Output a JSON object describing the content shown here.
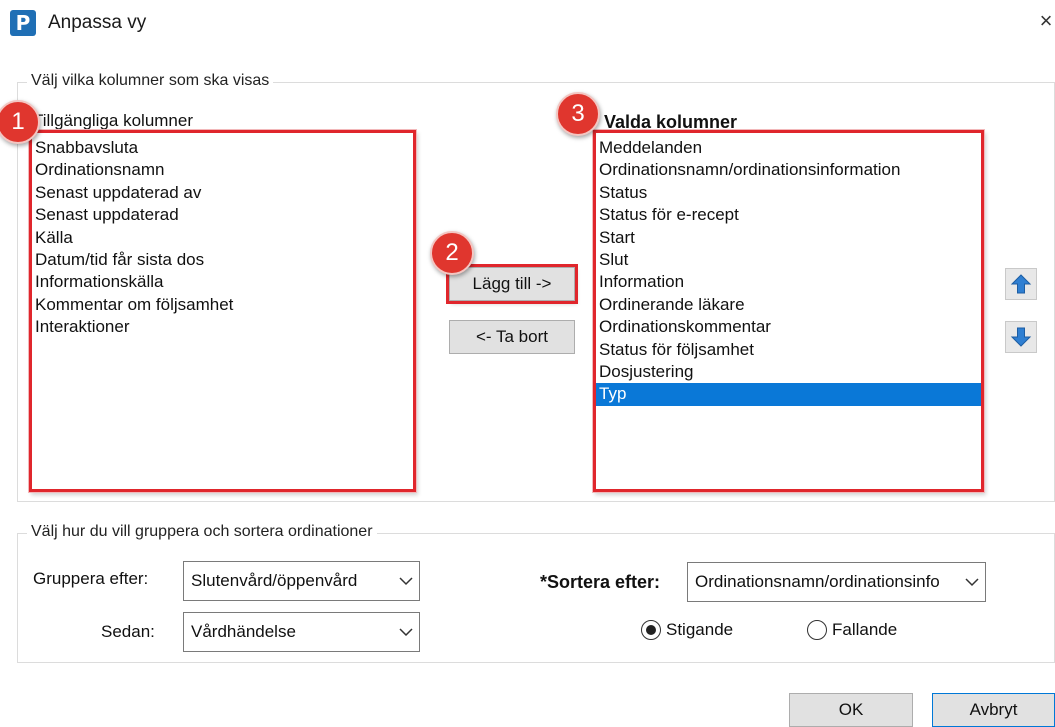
{
  "window": {
    "app_icon_letter": "P",
    "title": "Anpassa vy",
    "close_glyph": "×"
  },
  "columns_group": {
    "legend": "Välj vilka kolumner som ska visas",
    "available": {
      "label": "Tillgängliga kolumner",
      "items": [
        "Snabbavsluta",
        "Ordinationsnamn",
        "Senast uppdaterad av",
        "Senast uppdaterad",
        "Källa",
        "Datum/tid får sista dos",
        "Informationskälla",
        "Kommentar om följsamhet",
        "Interaktioner"
      ]
    },
    "selected": {
      "label": "Valda kolumner",
      "items": [
        "Meddelanden",
        "Ordinationsnamn/ordinationsinformation",
        "Status",
        "Status för e-recept",
        "Start",
        "Slut",
        "Information",
        "Ordinerande läkare",
        "Ordinationskommentar",
        "Status för följsamhet",
        "Dosjustering",
        "Typ"
      ],
      "selected_index": 11
    },
    "add_button": "Lägg till ->",
    "remove_button": "<- Ta bort",
    "move_up_icon": "arrow-up-icon",
    "move_down_icon": "arrow-down-icon"
  },
  "badges": [
    "1",
    "2",
    "3"
  ],
  "grouping_group": {
    "legend": "Välj hur du vill gruppera och sortera ordinationer",
    "group_by_label": "Gruppera efter:",
    "group_by_value": "Slutenvård/öppenvård",
    "then_label": "Sedan:",
    "then_value": "Vårdhändelse",
    "sort_by_label": "*Sortera efter:",
    "sort_by_value": "Ordinationsnamn/ordinationsinfo",
    "ascending_label": "Stigande",
    "descending_label": "Fallande",
    "sort_direction": "ascending"
  },
  "footer": {
    "ok": "OK",
    "cancel": "Avbryt"
  },
  "colors": {
    "highlight_red": "#e0262c",
    "selection_blue": "#0a78d7",
    "arrow_blue": "#2f7fd2"
  }
}
